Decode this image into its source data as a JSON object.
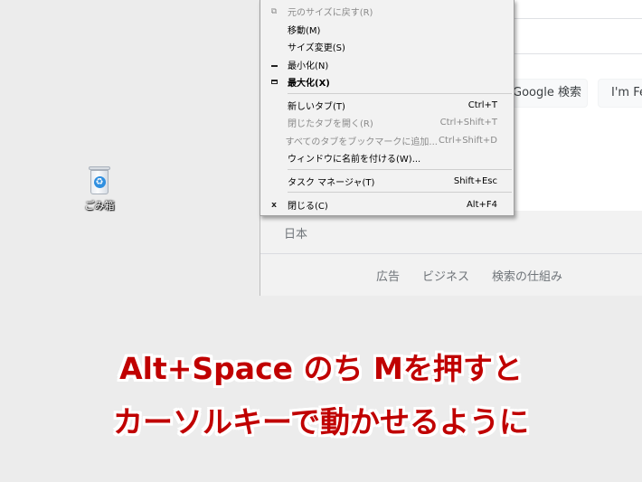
{
  "desktop": {
    "recycle_bin_label": "ごみ箱",
    "recycle_icon": "recycle-bin-icon"
  },
  "browser": {
    "search_button": "Google 検索",
    "lucky_button": "I'm Feeling Lucky",
    "footer": {
      "country": "日本",
      "links": [
        "広告",
        "ビジネス",
        "検索の仕組み"
      ]
    }
  },
  "system_menu": {
    "items": [
      {
        "icon": "restore-icon",
        "label": "元のサイズに戻す(R)",
        "shortcut": "",
        "disabled": true,
        "bold": false
      },
      {
        "icon": "",
        "label": "移動(M)",
        "shortcut": "",
        "disabled": false,
        "bold": false
      },
      {
        "icon": "",
        "label": "サイズ変更(S)",
        "shortcut": "",
        "disabled": false,
        "bold": false
      },
      {
        "icon": "minimize-icon",
        "label": "最小化(N)",
        "shortcut": "",
        "disabled": false,
        "bold": false
      },
      {
        "icon": "maximize-icon",
        "label": "最大化(X)",
        "shortcut": "",
        "disabled": false,
        "bold": true
      },
      {
        "icon": "",
        "label": "新しいタブ(T)",
        "shortcut": "Ctrl+T",
        "disabled": false,
        "bold": false
      },
      {
        "icon": "",
        "label": "閉じたタブを開く(R)",
        "shortcut": "Ctrl+Shift+T",
        "disabled": true,
        "bold": false
      },
      {
        "icon": "",
        "label": "すべてのタブをブックマークに追加...",
        "shortcut": "Ctrl+Shift+D",
        "disabled": true,
        "bold": false
      },
      {
        "icon": "",
        "label": "ウィンドウに名前を付ける(W)...",
        "shortcut": "",
        "disabled": false,
        "bold": false
      },
      {
        "icon": "",
        "label": "タスク マネージャ(T)",
        "shortcut": "Shift+Esc",
        "disabled": false,
        "bold": false
      },
      {
        "icon": "close-icon",
        "label": "閉じる(C)",
        "shortcut": "Alt+F4",
        "disabled": false,
        "bold": false
      }
    ]
  },
  "caption": {
    "line1": "Alt+Space のち Mを押すと",
    "line2": "カーソルキーで動かせるように"
  },
  "colors": {
    "caption_red": "#c00000",
    "menu_bg": "#f2f2f2",
    "desktop_bg": "#ececec"
  }
}
